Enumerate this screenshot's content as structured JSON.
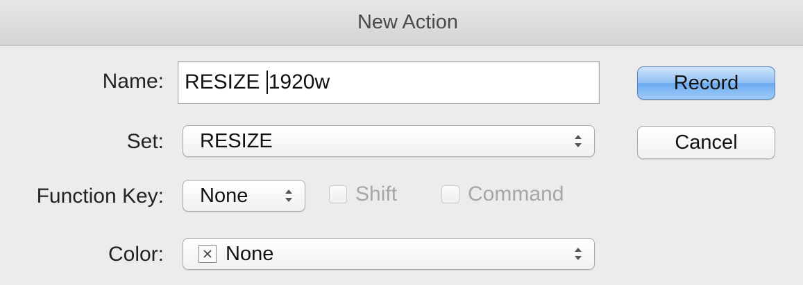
{
  "window": {
    "title": "New Action"
  },
  "form": {
    "name_label": "Name:",
    "name_value_before_caret": "RESIZE ",
    "name_value_after_caret": "1920w",
    "set_label": "Set:",
    "set_value": "RESIZE",
    "function_key_label": "Function Key:",
    "function_key_value": "None",
    "shift_label": "Shift",
    "shift_checked": false,
    "shift_enabled": false,
    "command_label": "Command",
    "command_checked": false,
    "command_enabled": false,
    "color_label": "Color:",
    "color_value": "None"
  },
  "buttons": {
    "record_label": "Record",
    "cancel_label": "Cancel"
  },
  "icons": {
    "popup_arrows": "up-down-arrows-icon",
    "color_swatch": "no-color-x-icon"
  },
  "colors": {
    "default_button": "#8fc0f3",
    "disabled_text": "#a6a6a6"
  }
}
